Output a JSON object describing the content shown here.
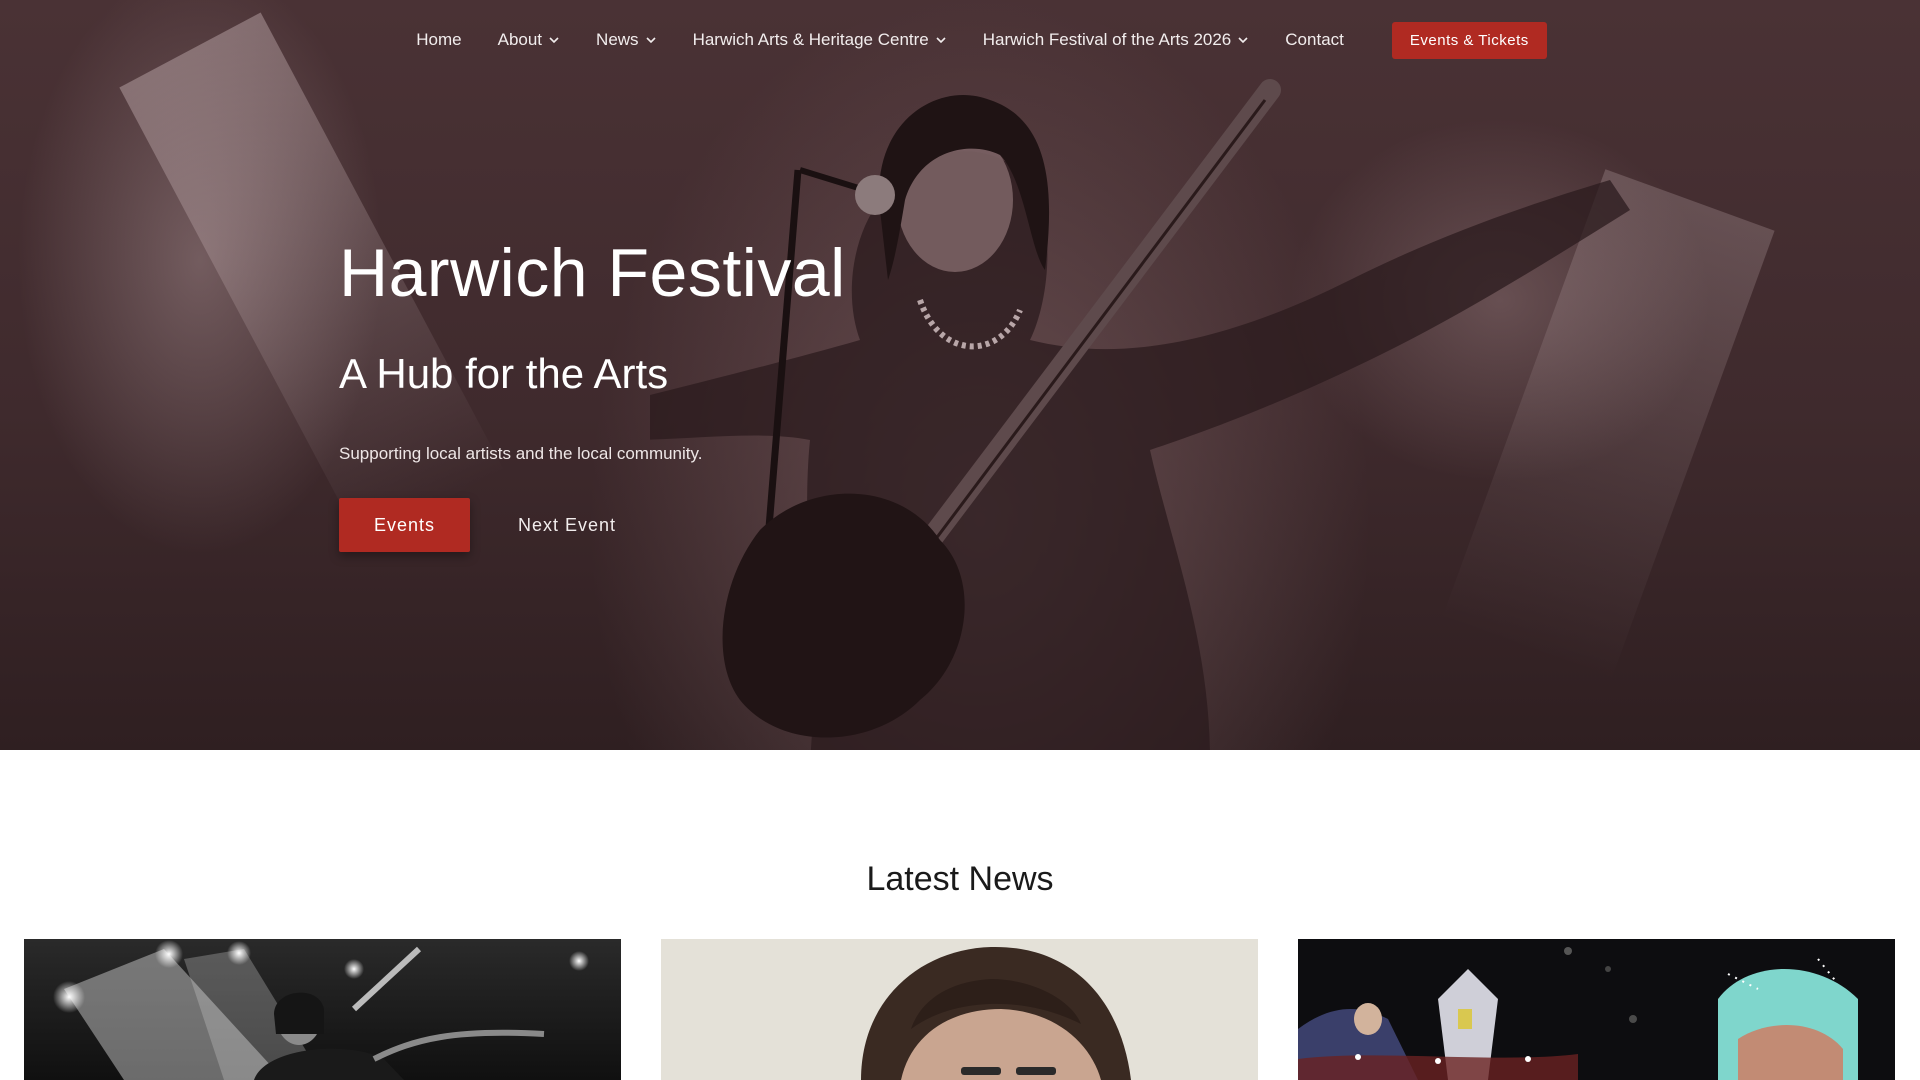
{
  "nav": {
    "items": [
      {
        "label": "Home",
        "has_dropdown": false
      },
      {
        "label": "About",
        "has_dropdown": true
      },
      {
        "label": "News",
        "has_dropdown": true
      },
      {
        "label": "Harwich Arts & Heritage Centre",
        "has_dropdown": true
      },
      {
        "label": "Harwich Festival of the Arts 2026",
        "has_dropdown": true
      },
      {
        "label": "Contact",
        "has_dropdown": false
      }
    ],
    "cta_label": "Events & Tickets"
  },
  "hero": {
    "title": "Harwich Festival",
    "subtitle": "A Hub for the Arts",
    "text": "Supporting local artists and the local community.",
    "primary_button": "Events",
    "secondary_button": "Next Event"
  },
  "latest_news": {
    "heading": "Latest News"
  },
  "colors": {
    "accent": "#b02a22",
    "hero_overlay": "#3f2a2d",
    "text_light": "#ffffff"
  },
  "icons": {
    "dropdown": "chevron-down-icon"
  }
}
